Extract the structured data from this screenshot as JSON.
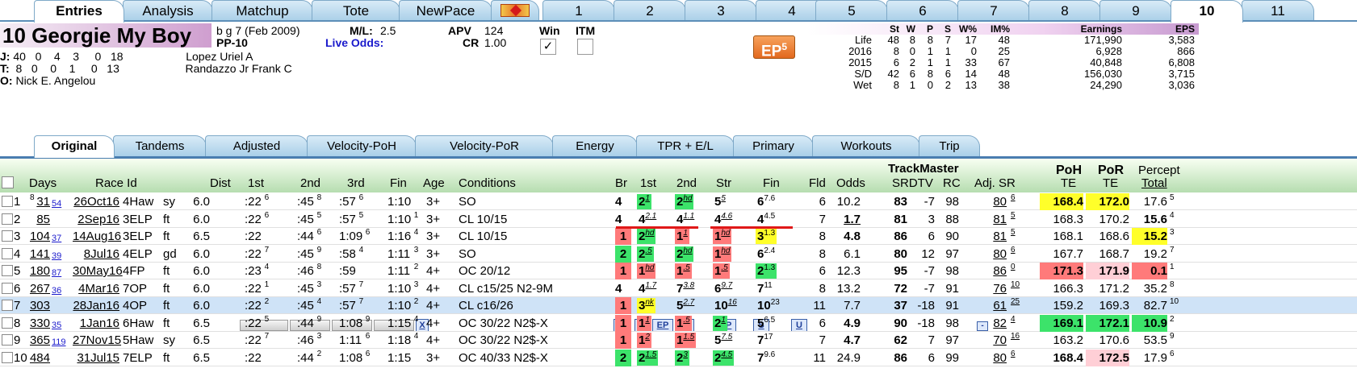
{
  "tabs_top": [
    {
      "label": "Entries",
      "active": true
    },
    {
      "label": "Analysis"
    },
    {
      "label": "Matchup"
    },
    {
      "label": "Tote"
    },
    {
      "label": "NewPace"
    },
    {
      "label": "icon"
    },
    {
      "label": "1"
    },
    {
      "label": "2"
    },
    {
      "label": "3"
    },
    {
      "label": "4"
    },
    {
      "label": "5"
    },
    {
      "label": "6"
    },
    {
      "label": "7"
    },
    {
      "label": "8"
    },
    {
      "label": "9"
    },
    {
      "label": "10",
      "active": true
    },
    {
      "label": "11"
    }
  ],
  "horse": {
    "name": "10  Georgie My Boy",
    "desc": "b g 7  (Feb 2009)",
    "pp": "PP-10",
    "ml_label": "M/L:",
    "ml": "2.5",
    "live_odds_label": "Live Odds:",
    "apv_label": "APV",
    "apv": "124",
    "cr_label": "CR",
    "cr": "1.00",
    "win_label": "Win",
    "win_checked": "✓",
    "itm_label": "ITM",
    "ep_badge": "EP",
    "ep_badge_num": "5",
    "jockey": {
      "label": "J:",
      "stats": "40   0    4    3     0   18",
      "name": "Lopez Uriel A"
    },
    "trainer": {
      "label": "T:",
      "stats": " 8   0    0    1     0   13",
      "name": "Randazzo Jr Frank C"
    },
    "owner": {
      "label": "O:",
      "name": "Nick E. Angelou"
    }
  },
  "record": {
    "headers": [
      "St",
      "W",
      "P",
      "S",
      "W%",
      "IM%",
      "Earnings",
      "EPS"
    ],
    "rows": [
      {
        "label": "Life",
        "st": "48",
        "w": "8",
        "p": "8",
        "s": "7",
        "wp": "17",
        "im": "48",
        "earn": "171,990",
        "eps": "3,583"
      },
      {
        "label": "2016",
        "st": "8",
        "w": "0",
        "p": "1",
        "s": "1",
        "wp": "0",
        "im": "25",
        "earn": "6,928",
        "eps": "866"
      },
      {
        "label": "2015",
        "st": "6",
        "w": "2",
        "p": "1",
        "s": "1",
        "wp": "33",
        "im": "67",
        "earn": "40,848",
        "eps": "6,808"
      },
      {
        "label": "S/D",
        "st": "42",
        "w": "6",
        "p": "8",
        "s": "6",
        "wp": "14",
        "im": "48",
        "earn": "156,030",
        "eps": "3,715"
      },
      {
        "label": "Wet",
        "st": "8",
        "w": "1",
        "p": "0",
        "s": "2",
        "wp": "13",
        "im": "38",
        "earn": "24,290",
        "eps": "3,036"
      }
    ]
  },
  "tabs_second": [
    {
      "label": "Original",
      "active": true
    },
    {
      "label": "Tandems"
    },
    {
      "label": "Adjusted"
    },
    {
      "label": "Velocity-PoH"
    },
    {
      "label": "Velocity-PoR"
    },
    {
      "label": "Energy"
    },
    {
      "label": "TPR + E/L"
    },
    {
      "label": "Primary"
    },
    {
      "label": "Workouts"
    },
    {
      "label": "Trip"
    }
  ],
  "grid_header": {
    "days": "Days",
    "race_id": "Race Id",
    "dist": "Dist",
    "first": "1st",
    "second": "2nd",
    "third": "3rd",
    "fin": "Fin",
    "x_btn": "X",
    "age": "Age",
    "conditions": "Conditions",
    "br": "Br",
    "first2": "1st",
    "second2": "2nd",
    "str": "Str",
    "fin2": "Fin",
    "fld": "Fld",
    "odds": "Odds",
    "trackmaster": "TrackMaster",
    "tm_btn": "-",
    "srdtv": "SRDTV",
    "rc": "RC",
    "adjsr": "Adj. SR",
    "poh": "PoH",
    "poh2": "TE",
    "por": "PoR",
    "por2": "TE",
    "percept": "Percept",
    "percept2": "Total",
    "fbtns": [
      "F",
      "E",
      "EP",
      "P",
      "SP",
      "S",
      "U"
    ]
  },
  "rows": [
    {
      "n": "1",
      "days": "31",
      "dsup": "8",
      "gap": "54",
      "date": "26Oct16",
      "trk": "4Haw",
      "cond": "sy",
      "dist": "6.0",
      "f1": ":22",
      "f1s": "6",
      "f2": ":45",
      "f2s": "8",
      "f3": ":57",
      "f3s": "6",
      "fin": "1:10",
      "fins": "",
      "age": "3+",
      "race": "SO",
      "br": "4",
      "p1": "2",
      "p1s": "1",
      "p1c": "grn",
      "p2": "2",
      "p2s": "hd",
      "p2c": "grn",
      "st": "5",
      "sts": "5",
      "stc": "",
      "fn": "6",
      "fns": "7.6",
      "fnc": "",
      "fld": "6",
      "odds": "10.2",
      "sr": "83",
      "dtv": "-7",
      "rc": "98",
      "adj": "80",
      "adjs": "6",
      "poh": "168.4",
      "pohc": "yel",
      "por": "172.0",
      "porc": "yel",
      "pct": "17.6",
      "pcts": "5",
      "pctc": ""
    },
    {
      "n": "2",
      "days": "85",
      "dsup": "",
      "gap": "",
      "date": "2Sep16",
      "trk": "3ELP",
      "cond": "ft",
      "dist": "6.0",
      "f1": ":22",
      "f1s": "6",
      "f2": ":45",
      "f2s": "5",
      "f3": ":57",
      "f3s": "5",
      "fin": "1:10",
      "fins": "1",
      "age": "3+",
      "race": "CL 10/15",
      "br": "4",
      "p1": "4",
      "p1s": "2.1",
      "p1c": "",
      "p2": "4",
      "p2s": "1.1",
      "p2c": "",
      "st": "4",
      "sts": "4.6",
      "stc": "",
      "fn": "4",
      "fns": "4.5",
      "fnc": "",
      "fld": "7",
      "odds": "1.7",
      "sr": "81",
      "dtv": "3",
      "rc": "88",
      "adj": "81",
      "adjs": "5",
      "poh": "168.3",
      "pohc": "",
      "por": "170.2",
      "porc": "",
      "pct": "15.6",
      "pcts": "4",
      "pctc": "bold"
    },
    {
      "n": "3",
      "days": "104",
      "dsup": "",
      "gap": "37",
      "date": "14Aug16",
      "trk": "3ELP",
      "cond": "ft",
      "dist": "6.5",
      "f1": ":22",
      "f1s": "",
      "f2": ":44",
      "f2s": "6",
      "f3": "1:09",
      "f3s": "6",
      "fin": "1:16",
      "fins": "4",
      "age": "3+",
      "race": "CL 10/15",
      "br": "1",
      "p1": "2",
      "p1s": "hd",
      "p1c": "grn",
      "p2": "1",
      "p2s": "1",
      "p2c": "red",
      "st": "1",
      "sts": "hd",
      "stc": "red",
      "fn": "3",
      "fns": "1.3",
      "fnc": "yel",
      "fld": "8",
      "odds": "4.8",
      "sr": "86",
      "dtv": "6",
      "rc": "90",
      "adj": "81",
      "adjs": "5",
      "poh": "168.1",
      "pohc": "",
      "por": "168.6",
      "porc": "",
      "pct": "15.2",
      "pcts": "3",
      "pctc": "yel"
    },
    {
      "n": "4",
      "days": "141",
      "dsup": "",
      "gap": "39",
      "date": "8Jul16",
      "trk": "4ELP",
      "cond": "gd",
      "dist": "6.0",
      "f1": ":22",
      "f1s": "7",
      "f2": ":45",
      "f2s": "9",
      "f3": ":58",
      "f3s": "4",
      "fin": "1:11",
      "fins": "3",
      "age": "3+",
      "race": "SO",
      "br": "2",
      "p1": "2",
      "p1s": ".5",
      "p1c": "grn",
      "p2": "2",
      "p2s": "hd",
      "p2c": "grn",
      "st": "1",
      "sts": "hd",
      "stc": "red",
      "fn": "6",
      "fns": "2.4",
      "fnc": "",
      "fld": "8",
      "odds": "6.1",
      "sr": "80",
      "dtv": "12",
      "rc": "97",
      "adj": "80",
      "adjs": "6",
      "poh": "167.7",
      "pohc": "",
      "por": "168.7",
      "porc": "",
      "pct": "19.2",
      "pcts": "7",
      "pctc": ""
    },
    {
      "n": "5",
      "days": "180",
      "dsup": "",
      "gap": "87",
      "date": "30May16",
      "trk": "4FP",
      "cond": "ft",
      "dist": "6.0",
      "f1": ":23",
      "f1s": "4",
      "f2": ":46",
      "f2s": "8",
      "f3": ":59",
      "f3s": "",
      "fin": "1:11",
      "fins": "2",
      "age": "4+",
      "race": "OC 20/12",
      "br": "1",
      "p1": "1",
      "p1s": "hd",
      "p1c": "red",
      "p2": "1",
      "p2s": ".5",
      "p2c": "red",
      "st": "1",
      "sts": ".5",
      "stc": "red",
      "fn": "2",
      "fns": "1.3",
      "fnc": "grn",
      "fld": "6",
      "odds": "12.3",
      "sr": "95",
      "dtv": "-7",
      "rc": "98",
      "adj": "86",
      "adjs": "0",
      "poh": "171.3",
      "pohc": "red",
      "por": "171.9",
      "porc": "pink",
      "pct": "0.1",
      "pcts": "1",
      "pctc": "red"
    },
    {
      "n": "6",
      "days": "267",
      "dsup": "",
      "gap": "36",
      "date": "4Mar16",
      "trk": "7OP",
      "cond": "ft",
      "dist": "6.0",
      "f1": ":22",
      "f1s": "1",
      "f2": ":45",
      "f2s": "3",
      "f3": ":57",
      "f3s": "7",
      "fin": "1:10",
      "fins": "3",
      "age": "4+",
      "race": "CL c15/25 N2-9M",
      "br": "4",
      "p1": "4",
      "p1s": "1.7",
      "p1c": "",
      "p2": "7",
      "p2s": "3.8",
      "p2c": "",
      "st": "6",
      "sts": "9.7",
      "stc": "",
      "fn": "7",
      "fns": "11",
      "fnc": "",
      "fld": "8",
      "odds": "13.2",
      "sr": "72",
      "dtv": "-7",
      "rc": "91",
      "adj": "76",
      "adjs": "10",
      "poh": "166.3",
      "pohc": "",
      "por": "171.2",
      "porc": "",
      "pct": "35.2",
      "pcts": "8",
      "pctc": ""
    },
    {
      "n": "7",
      "days": "303",
      "dsup": "",
      "gap": "",
      "date": "28Jan16",
      "trk": "4OP",
      "cond": "ft",
      "dist": "6.0",
      "f1": ":22",
      "f1s": "2",
      "f2": ":45",
      "f2s": "4",
      "f3": ":57",
      "f3s": "7",
      "fin": "1:10",
      "fins": "2",
      "age": "4+",
      "race": "CL c16/26",
      "br": "1",
      "p1": "3",
      "p1s": "nk",
      "p1c": "yel",
      "p2": "5",
      "p2s": "2.7",
      "p2c": "",
      "st": "10",
      "sts": "16",
      "stc": "",
      "fn": "10",
      "fns": "23",
      "fnc": "",
      "fld": "11",
      "odds": "7.7",
      "sr": "37",
      "dtv": "-18",
      "rc": "91",
      "adj": "61",
      "adjs": "25",
      "poh": "159.2",
      "pohc": "",
      "por": "169.3",
      "porc": "",
      "pct": "82.7",
      "pcts": "10",
      "pctc": ""
    },
    {
      "n": "8",
      "days": "330",
      "dsup": "",
      "gap": "35",
      "date": "1Jan16",
      "trk": "6Haw",
      "cond": "ft",
      "dist": "6.5",
      "f1": ":22",
      "f1s": "5",
      "f2": ":44",
      "f2s": "9",
      "f3": "1:08",
      "f3s": "9",
      "fin": "1:15",
      "fins": "4",
      "age": "4+",
      "race": "OC 30/22 N2$-X",
      "br": "1",
      "p1": "1",
      "p1s": "1",
      "p1c": "red",
      "p2": "1",
      "p2s": ".5",
      "p2c": "red",
      "st": "2",
      "sts": "1",
      "stc": "grn",
      "fn": "5",
      "fns": "6.5",
      "fnc": "",
      "fld": "6",
      "odds": "4.9",
      "sr": "90",
      "dtv": "-18",
      "rc": "98",
      "adj": "82",
      "adjs": "4",
      "poh": "169.1",
      "pohc": "grn",
      "por": "172.1",
      "porc": "grn",
      "pct": "10.9",
      "pcts": "2",
      "pctc": "grn"
    },
    {
      "n": "9",
      "days": "365",
      "dsup": "",
      "gap": "119",
      "date": "27Nov15",
      "trk": "5Haw",
      "cond": "sy",
      "dist": "6.5",
      "f1": ":22",
      "f1s": "7",
      "f2": ":46",
      "f2s": "3",
      "f3": "1:11",
      "f3s": "6",
      "fin": "1:18",
      "fins": "4",
      "age": "4+",
      "race": "OC 30/22 N2$-X",
      "br": "1",
      "p1": "1",
      "p1s": "2",
      "p1c": "red",
      "p2": "1",
      "p2s": "1.5",
      "p2c": "red",
      "st": "5",
      "sts": "7.5",
      "stc": "",
      "fn": "7",
      "fns": "17",
      "fnc": "",
      "fld": "7",
      "odds": "4.7",
      "sr": "62",
      "dtv": "7",
      "rc": "97",
      "adj": "70",
      "adjs": "16",
      "poh": "163.2",
      "pohc": "",
      "por": "170.6",
      "porc": "",
      "pct": "53.5",
      "pcts": "9",
      "pctc": ""
    },
    {
      "n": "10",
      "days": "484",
      "dsup": "",
      "gap": "",
      "date": "31Jul15",
      "trk": "7ELP",
      "cond": "ft",
      "dist": "6.5",
      "f1": ":22",
      "f1s": "",
      "f2": ":44",
      "f2s": "2",
      "f3": "1:08",
      "f3s": "6",
      "fin": "1:15",
      "fins": "",
      "age": "3+",
      "race": "OC 40/33 N2$-X",
      "br": "2",
      "p1": "2",
      "p1s": "1.5",
      "p1c": "grn",
      "p2": "2",
      "p2s": "3",
      "p2c": "grn",
      "st": "2",
      "sts": "4.5",
      "stc": "grn",
      "fn": "7",
      "fns": "9.6",
      "fnc": "",
      "fld": "11",
      "odds": "24.9",
      "sr": "86",
      "dtv": "6",
      "rc": "99",
      "adj": "80",
      "adjs": "6",
      "poh": "168.4",
      "pohc": "",
      "por": "172.5",
      "porc": "pink",
      "pct": "17.9",
      "pcts": "6",
      "pctc": ""
    }
  ]
}
